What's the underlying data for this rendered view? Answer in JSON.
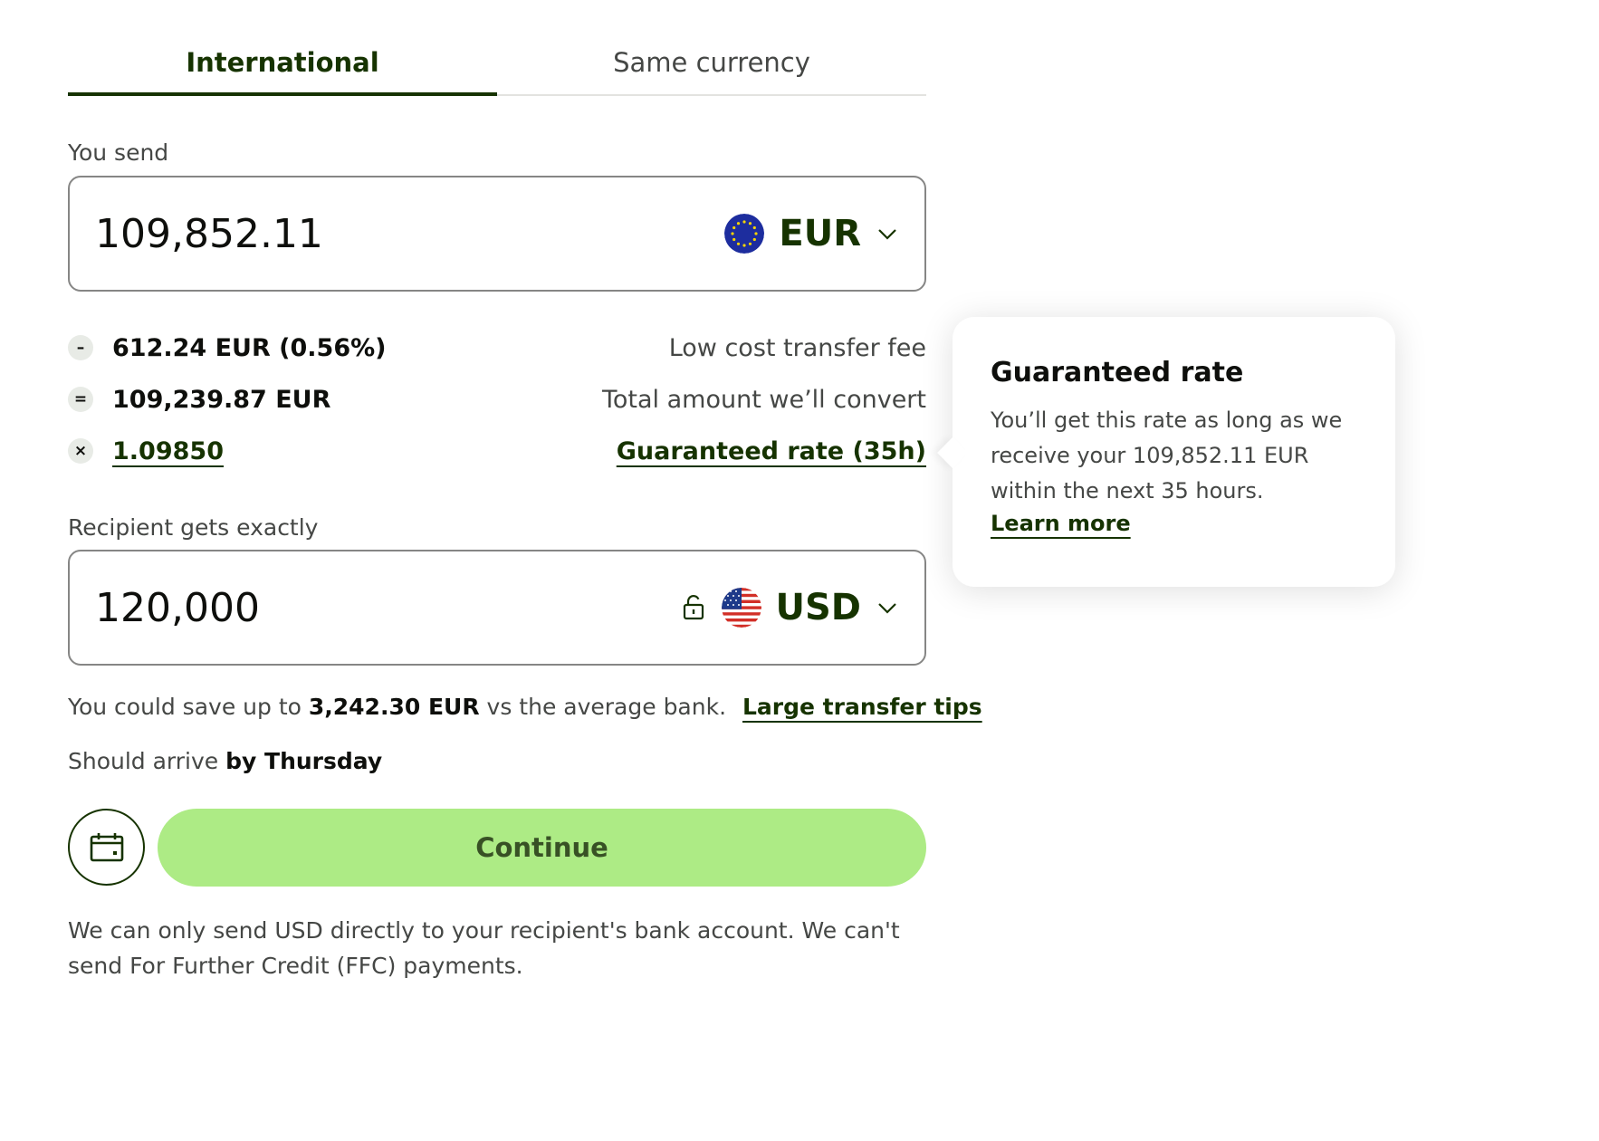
{
  "tabs": [
    {
      "label": "International",
      "active": true
    },
    {
      "label": "Same currency",
      "active": false
    }
  ],
  "send": {
    "label": "You send",
    "amount": "109,852.11",
    "currency": "EUR",
    "flag_icon": "eu-flag-icon"
  },
  "fees": [
    {
      "operator": "–",
      "value": "612.24 EUR (0.56%)",
      "label": "Low cost transfer fee"
    },
    {
      "operator": "=",
      "value": "109,239.87 EUR",
      "label": "Total amount we’ll convert"
    },
    {
      "operator": "×",
      "value": "1.09850",
      "label": "Guaranteed rate (35h)"
    }
  ],
  "receive": {
    "label": "Recipient gets exactly",
    "amount": "120,000",
    "currency": "USD",
    "flag_icon": "us-flag-icon"
  },
  "savings": {
    "prefix": "You could save up to",
    "amount": "3,242.30 EUR",
    "suffix": "vs the average bank.",
    "link": "Large transfer tips"
  },
  "arrival": {
    "prefix": "Should arrive",
    "when": "by Thursday"
  },
  "actions": {
    "continue_label": "Continue"
  },
  "note": "We can only send USD directly to your recipient's bank account. We can't send For Further Credit (FFC) payments.",
  "tooltip": {
    "title": "Guaranteed rate",
    "body": "You’ll get this rate as long as we receive your 109,852.11 EUR within the next 35 hours.",
    "link": "Learn more"
  },
  "colors": {
    "brand_dark_green": "#163300",
    "bright_green": "#9fe870",
    "text_secondary": "#454745",
    "border": "#868685"
  }
}
